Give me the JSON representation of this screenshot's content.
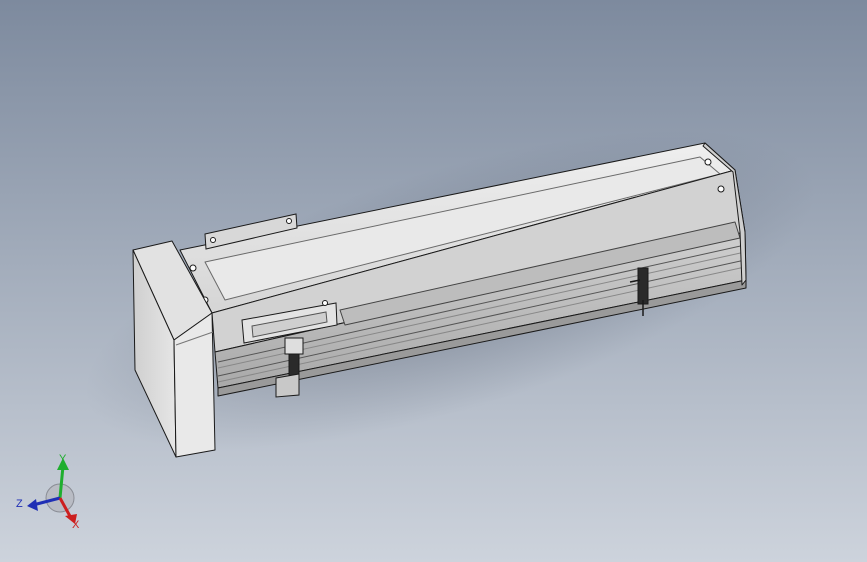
{
  "viewport": {
    "background_top": "#7d8a9e",
    "background_bottom": "#cdd3dc"
  },
  "model": {
    "name": "linear-module-assembly",
    "body_color": "#dcdcdc",
    "edge_color": "#1a1a1a",
    "shadow_color": "#6e7787"
  },
  "triad": {
    "x_label": "X",
    "y_label": "Y",
    "z_label": "Z",
    "x_color": "#cc1f1f",
    "y_color": "#1fae2e",
    "z_color": "#1f2fb5"
  }
}
